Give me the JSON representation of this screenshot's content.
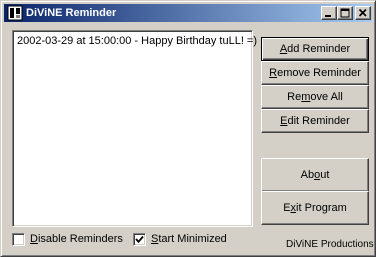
{
  "window": {
    "title": "DiViNE Reminder",
    "icon": "app-icon",
    "caption_buttons": [
      "minimize-icon",
      "maximize-icon",
      "close-icon"
    ]
  },
  "reminders": {
    "items": [
      {
        "text": "2002-03-29 at 15:00:00 - Happy Birthday tuLL! =)"
      }
    ]
  },
  "buttons": {
    "add": {
      "mnemonic": "A",
      "rest": "dd Reminder"
    },
    "remove": {
      "mnemonic": "R",
      "rest": "emove Reminder"
    },
    "remove_all": {
      "pre": "Re",
      "mnemonic": "m",
      "rest": "ove All"
    },
    "edit": {
      "mnemonic": "E",
      "rest": "dit Reminder"
    },
    "about": {
      "pre": "Ab",
      "mnemonic": "o",
      "rest": "ut"
    },
    "exit": {
      "pre": "E",
      "mnemonic": "x",
      "rest": "it Program"
    }
  },
  "options": {
    "disable": {
      "mnemonic": "D",
      "rest": "isable Reminders",
      "checked": false
    },
    "start_minimized": {
      "mnemonic": "S",
      "rest": "tart Minimized",
      "checked": true
    }
  },
  "footer": {
    "text": "DiViNE Productions"
  },
  "colors": {
    "titlebar_start": "#0a246a",
    "titlebar_end": "#a6caf0",
    "face": "#d4d0c8"
  }
}
